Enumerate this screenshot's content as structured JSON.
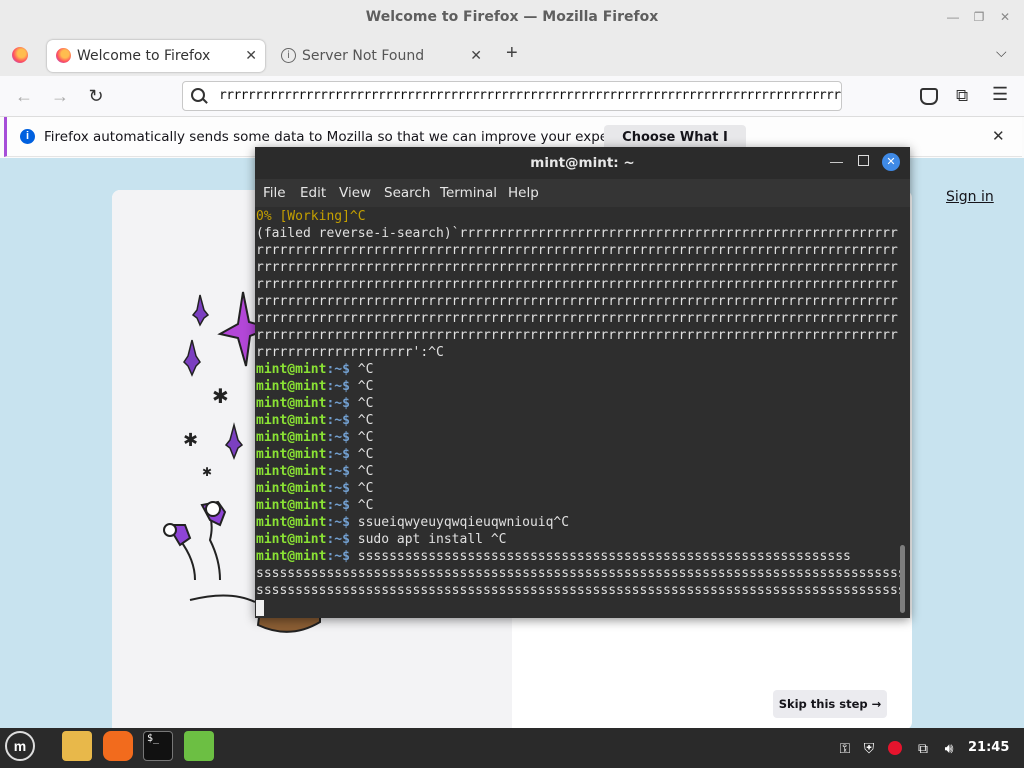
{
  "window": {
    "title": "Welcome to Firefox — Mozilla Firefox"
  },
  "tabs": [
    {
      "label": "Welcome to Firefox",
      "active": true
    },
    {
      "label": "Server Not Found",
      "active": false
    }
  ],
  "urlbar": {
    "value": "rrrrrrrrrrrrrrrrrrrrrrrrrrrrrrrrrrrrrrrrrrrrrrrrrrrrrrrrrrrrrrrrrrrrrrrrrrrrrrrrrrrrrrrrrrrrrrrrrrrrrrrr"
  },
  "notification": {
    "text": "Firefox automatically sends some data to Mozilla so that we can improve your experience.",
    "button": "Choose What I Share"
  },
  "page": {
    "sign_in": "Sign in",
    "skip_button": "Skip this step →"
  },
  "terminal": {
    "title": "mint@mint: ~",
    "menu": [
      "File",
      "Edit",
      "View",
      "Search",
      "Terminal",
      "Help"
    ],
    "prompt_user": "mint@mint",
    "prompt_path": ":~$",
    "line_working": "0% [Working]^C",
    "line_search_start": "(failed reverse-i-search)`rrrrrrrrrrrrrrrrrrrrrrrrrrrrrrrrrrrrrrrrrrrrrrrrrrrrrrrrrrrrr",
    "line_r": "rrrrrrrrrrrrrrrrrrrrrrrrrrrrrrrrrrrrrrrrrrrrrrrrrrrrrrrrrrrrrrrrrrrrrrrrrrrrrrrrrrrrrrr",
    "line_search_end": "rrrrrrrrrrrrrrrrrrrr':^C",
    "cmd_ctrl_c": " ^C",
    "cmd_typed": " ssueiqwyeuyqwqieuqwniouiq^C",
    "cmd_apt": " sudo apt install ^C",
    "cmd_s_start": " sssssssssssssssssssssssssssssssssssssssssssssssssssssssssssssss",
    "line_s": "ssssssssssssssssssssssssssssssssssssssssssssssssssssssssssssssssssssssssssssssssssssssssssssss"
  },
  "taskbar": {
    "clock": "21:45"
  },
  "colors": {
    "prompt_green": "#8ae234",
    "prompt_blue": "#729fcf",
    "terminal_bg": "#2e2e2e",
    "page_bg": "#c8e3ef",
    "accent_purple": "#a64ed8"
  }
}
